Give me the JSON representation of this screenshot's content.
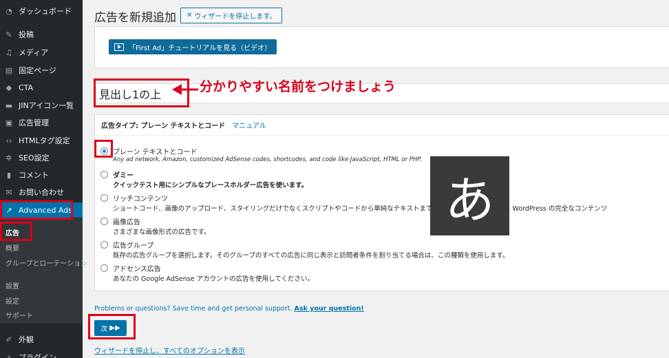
{
  "sidebar": {
    "items": [
      {
        "label": "ダッシュボード",
        "icon": "dashboard-icon",
        "glyph": "◔"
      },
      {
        "label": "投稿",
        "icon": "pin-icon",
        "glyph": "✎"
      },
      {
        "label": "メディア",
        "icon": "media-icon",
        "glyph": "♫"
      },
      {
        "label": "固定ページ",
        "icon": "page-icon",
        "glyph": "▤"
      },
      {
        "label": "CTA",
        "icon": "tag-icon",
        "glyph": "◆"
      },
      {
        "label": "JINアイコン一覧",
        "icon": "list-icon",
        "glyph": "▬"
      },
      {
        "label": "広告管理",
        "icon": "ad-icon",
        "glyph": "▣"
      },
      {
        "label": "HTMLタグ設定",
        "icon": "code-icon",
        "glyph": "‹›"
      },
      {
        "label": "SEO設定",
        "icon": "gear-icon",
        "glyph": "✲"
      },
      {
        "label": "コメント",
        "icon": "comment-icon",
        "glyph": "▮"
      },
      {
        "label": "お問い合わせ",
        "icon": "mail-icon",
        "glyph": "✉"
      },
      {
        "label": "Advanced Ads",
        "icon": "chart-icon",
        "glyph": "↗"
      }
    ],
    "submenu": [
      "広告",
      "概要",
      "グループとローテーション",
      "設置",
      "設定",
      "サポート"
    ],
    "bottom_items": [
      {
        "label": "外観",
        "icon": "brush-icon",
        "glyph": "✐"
      },
      {
        "label": "プラグイン",
        "icon": "plugin-icon",
        "glyph": "⚡"
      }
    ]
  },
  "main": {
    "title": "広告を新規追加",
    "stop_wizard_label": "ウィザードを停止します。",
    "tutorial_button": "「First Ad」チュートリアルを見る（ビデオ）",
    "ad_title_value": "見出し1の上",
    "annotation": "分かりやすい名前をつけましょう",
    "ad_type": {
      "header_label": "広告タイプ: プレーン テキストとコード",
      "manual_link": "マニュアル",
      "options": [
        {
          "title": "プレーン テキストとコード",
          "desc": "Any ad network, Amazon, customized AdSense codes, shortcodes, and code like JavaScript, HTML or PHP.",
          "checked": true
        },
        {
          "title": "ダミー",
          "desc": "クイックテスト用にシンプルなプレースホルダー広告を使います。",
          "checked": false
        },
        {
          "title": "リッチコンテンツ",
          "desc": "ショートコード、画像のアップロード、スタイリングだけでなくスクリプトやコードから単純なテキストまで…をすべての機能を備えた WordPress の完全なコンテンツ",
          "checked": false
        },
        {
          "title": "画像広告",
          "desc": "さまざまな画像形式の広告です。",
          "checked": false
        },
        {
          "title": "広告グループ",
          "desc": "既存の広告グループを選択します。そのグループのすべての広告に同じ表示と訪問者条件を割り当てる場合は、この種類を使用します。",
          "checked": false
        },
        {
          "title": "アドセンス広告",
          "desc": "あなたの Google AdSense アカウントの広告を使用してください。",
          "checked": false
        }
      ]
    },
    "overlay_char": "あ",
    "support_text": "Problems or questions? Save time and get personal support.",
    "support_link": "Ask your question!",
    "next_label": "次",
    "next_arrow": "▶▶",
    "stop_show_all": "ウィザードを停止し、すべてのオプションを表示"
  }
}
